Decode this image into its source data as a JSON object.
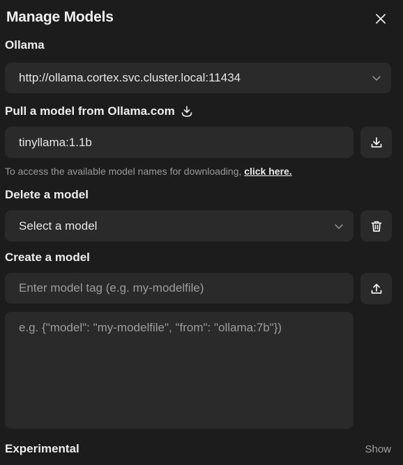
{
  "header": {
    "title": "Manage Models"
  },
  "ollama": {
    "label": "Ollama",
    "url_value": "http://ollama.cortex.svc.cluster.local:11434"
  },
  "pull": {
    "label": "Pull a model from Ollama.com",
    "input_value": "tinyllama:1.1b",
    "hint_text": "To access the available model names for downloading, ",
    "hint_link": "click here."
  },
  "delete": {
    "label": "Delete a model",
    "select_value": "Select a model"
  },
  "create": {
    "label": "Create a model",
    "tag_placeholder": "Enter model tag (e.g. my-modelfile)",
    "modelfile_placeholder": "e.g. {\"model\": \"my-modelfile\", \"from\": \"ollama:7b\"})"
  },
  "experimental": {
    "label": "Experimental",
    "toggle_label": "Show"
  },
  "icons": {
    "close": "close-icon",
    "chevron": "chevron-down-icon",
    "pull_inline": "download-tray-icon",
    "download": "download-icon",
    "delete": "trash-icon",
    "upload": "upload-icon"
  }
}
